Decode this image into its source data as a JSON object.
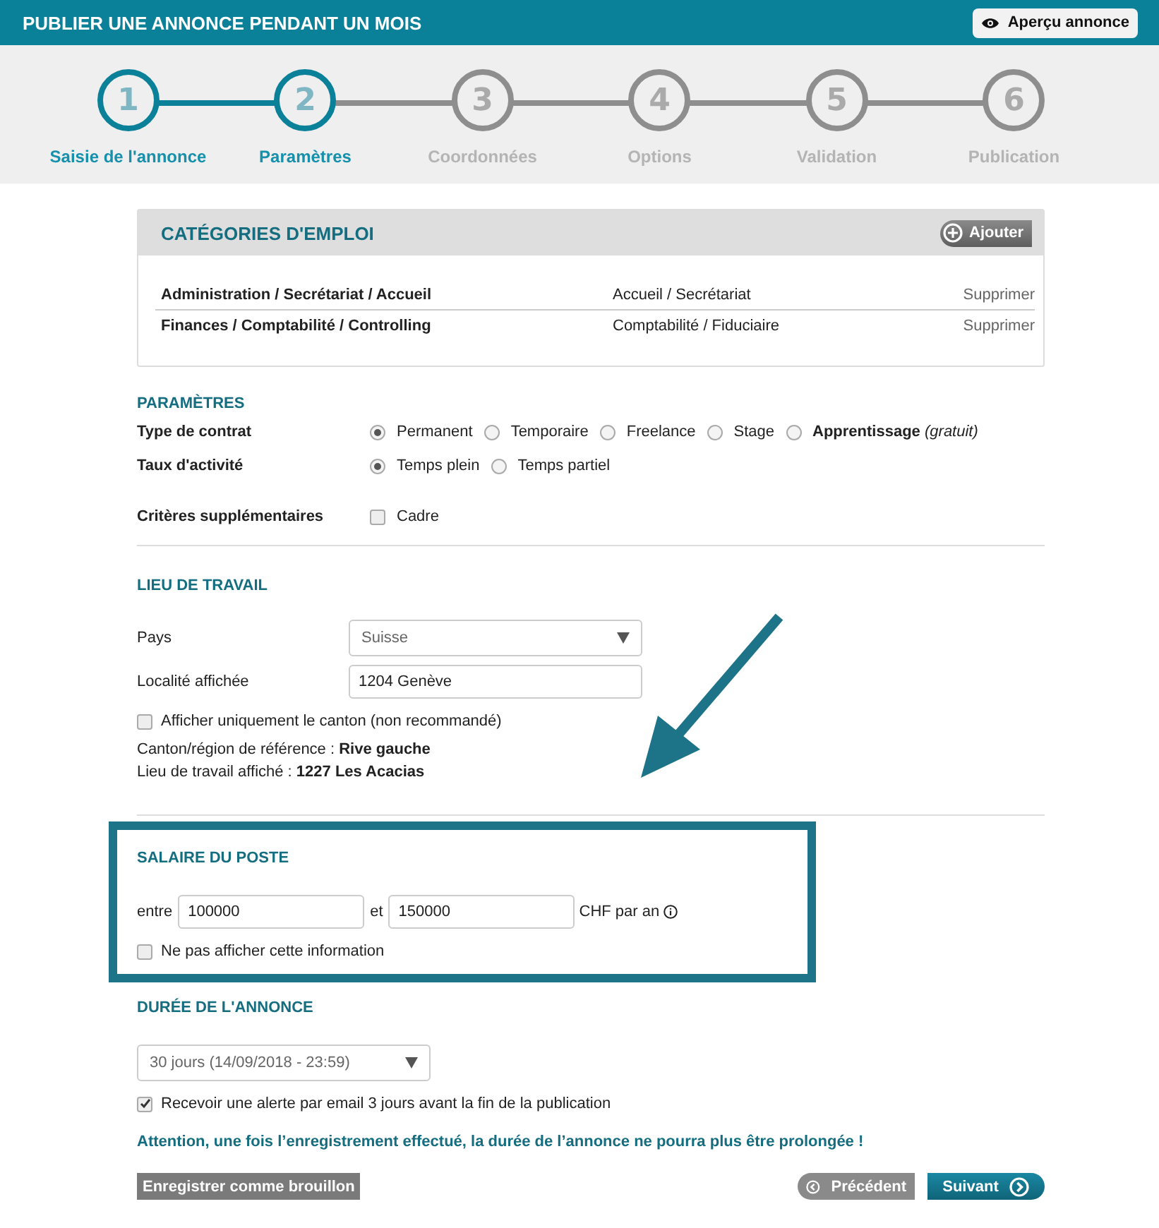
{
  "header": {
    "title": "PUBLIER UNE ANNONCE PENDANT UN MOIS",
    "preview_button": "Aperçu annonce"
  },
  "steps": [
    {
      "number": "1",
      "label": "Saisie de l'annonce",
      "active": true
    },
    {
      "number": "2",
      "label": "Paramètres",
      "active": true
    },
    {
      "number": "3",
      "label": "Coordonnées",
      "active": false
    },
    {
      "number": "4",
      "label": "Options",
      "active": false
    },
    {
      "number": "5",
      "label": "Validation",
      "active": false
    },
    {
      "number": "6",
      "label": "Publication",
      "active": false
    }
  ],
  "categories": {
    "title": "CATÉGORIES D'EMPLOI",
    "add_button": "Ajouter",
    "rows": [
      {
        "category": "Administration / Secrétariat / Accueil",
        "subcategory": "Accueil / Secrétariat",
        "action": "Supprimer"
      },
      {
        "category": "Finances / Comptabilité / Controlling",
        "subcategory": "Comptabilité / Fiduciaire",
        "action": "Supprimer"
      }
    ]
  },
  "parameters": {
    "title": "PARAMÈTRES",
    "rows": [
      {
        "kind": "radio",
        "label": "Type de contrat",
        "options": [
          {
            "label": "Permanent",
            "selected": true
          },
          {
            "label": "Temporaire",
            "selected": false
          },
          {
            "label": "Freelance",
            "selected": false
          },
          {
            "label": "Stage",
            "selected": false
          },
          {
            "label": "**Apprentissage** *(gratuit)*",
            "selected": false
          }
        ]
      },
      {
        "kind": "radio",
        "label": "Taux d'activité",
        "options": [
          {
            "label": "Temps plein",
            "selected": true
          },
          {
            "label": "Temps partiel",
            "selected": false
          }
        ]
      },
      {
        "kind": "checkbox",
        "label": "Critères supplémentaires",
        "options": [
          {
            "label": "Cadre",
            "checked": false
          }
        ]
      }
    ]
  },
  "workplace": {
    "title": "LIEU DE TRAVAIL",
    "country_label": "Pays",
    "country_value": "Suisse",
    "locality_label": "Localité affichée",
    "locality_value": "1204 Genève",
    "canton_only": {
      "label": "Afficher uniquement le canton (non recommandé)",
      "checked": false
    },
    "info": [
      "Canton/région de référence : **Rive gauche**",
      "Lieu de travail affiché : **1227 Les Acacias**"
    ]
  },
  "salary": {
    "title": "SALAIRE DU POSTE",
    "from_label": "entre",
    "from_value": "100000",
    "to_label": "et",
    "to_value": "150000",
    "unit": "CHF par an",
    "hide": {
      "label": "Ne pas afficher cette information",
      "checked": false
    }
  },
  "duration": {
    "title": "DURÉE DE L'ANNONCE",
    "value": "30 jours (14/09/2018 - 23:59)",
    "alert": {
      "label": "Recevoir une alerte par email 3 jours avant la fin de la publication",
      "checked": true
    },
    "warning": "Attention, une fois l’enregistrement effectué, la durée de l’annonce ne pourra plus être prolongée !"
  },
  "footer": {
    "draft_button": "Enregistrer comme brouillon",
    "previous_button": "Précédent",
    "next_button": "Suivant"
  }
}
